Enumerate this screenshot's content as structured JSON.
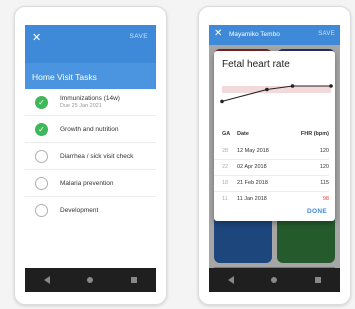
{
  "phone_a": {
    "appbar": {
      "close": "✕",
      "save": "SAVE"
    },
    "title": "Home Visit Tasks",
    "tasks": [
      {
        "label": "Immunizations (14w)",
        "sub": "Due 25 Jan 2021",
        "done": true
      },
      {
        "label": "Growth and nutrition",
        "sub": "",
        "done": true
      },
      {
        "label": "Diarrhea / sick visit check",
        "sub": "",
        "done": false
      },
      {
        "label": "Malaria prevention",
        "sub": "",
        "done": false
      },
      {
        "label": "Development",
        "sub": "",
        "done": false
      }
    ]
  },
  "phone_b": {
    "appbar": {
      "close": "✕",
      "name": "Mayamiko Tembo",
      "save": "SAVE"
    },
    "dialog": {
      "title": "Fetal heart rate",
      "headers": {
        "ga": "GA",
        "date": "Date",
        "fhr": "FHR (bpm)"
      },
      "rows": [
        {
          "ga": "28",
          "date": "12 May 2018",
          "fhr": "120"
        },
        {
          "ga": "22",
          "date": "02 Apr 2018",
          "fhr": "120"
        },
        {
          "ga": "18",
          "date": "21 Feb 2018",
          "fhr": "115"
        },
        {
          "ga": "11",
          "date": "11 Jan 2018",
          "fhr": "98"
        }
      ],
      "done": "DONE"
    }
  },
  "chart_data": {
    "type": "line",
    "x": [
      11,
      18,
      22,
      28
    ],
    "values": [
      98,
      115,
      120,
      120
    ],
    "ylim": [
      90,
      130
    ],
    "colors": {
      "line": "#222222",
      "band": "#f3d9d9"
    }
  },
  "colors": {
    "accent": "#3f8ad8",
    "check": "#3fb75b",
    "alert": "#e04444"
  }
}
